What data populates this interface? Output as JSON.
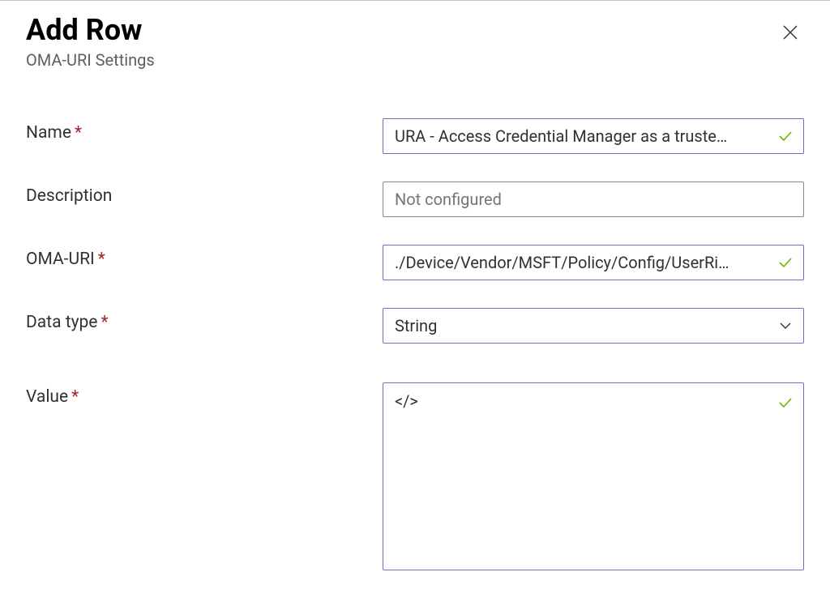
{
  "header": {
    "title": "Add Row",
    "subtitle": "OMA-URI Settings"
  },
  "form": {
    "name": {
      "label": "Name",
      "required": true,
      "value": "URA - Access Credential Manager as a truste…",
      "validated": true
    },
    "description": {
      "label": "Description",
      "required": false,
      "value": "",
      "placeholder": "Not configured"
    },
    "omaUri": {
      "label": "OMA-URI",
      "required": true,
      "value": "./Device/Vendor/MSFT/Policy/Config/UserRi…",
      "validated": true
    },
    "dataType": {
      "label": "Data type",
      "required": true,
      "selected": "String"
    },
    "value": {
      "label": "Value",
      "required": true,
      "value": "</>",
      "validated": true
    }
  },
  "colors": {
    "accent": "#8661c5",
    "success": "#6bb700",
    "required": "#a4262c"
  }
}
